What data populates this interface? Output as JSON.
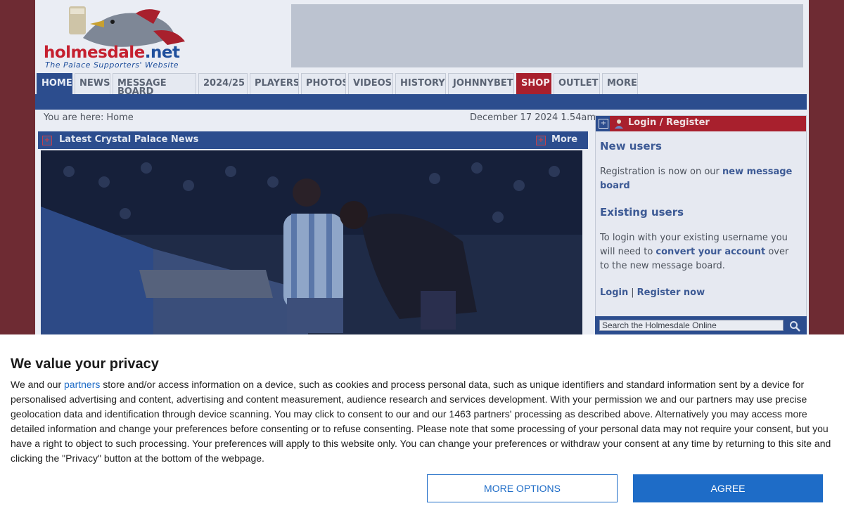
{
  "logo": {
    "name_main": "holmesdale",
    "name_suffix": ".net",
    "tagline": "The Palace Supporters' Website"
  },
  "nav": {
    "tabs": [
      {
        "label": "HOME",
        "name": "tab-home"
      },
      {
        "label": "NEWS",
        "name": "tab-news"
      },
      {
        "label": "MESSAGE BOARD",
        "name": "tab-message-board"
      },
      {
        "label": "2024/25",
        "name": "tab-2024-25"
      },
      {
        "label": "PLAYERS",
        "name": "tab-players"
      },
      {
        "label": "PHOTOS",
        "name": "tab-photos"
      },
      {
        "label": "VIDEOS",
        "name": "tab-videos"
      },
      {
        "label": "HISTORY",
        "name": "tab-history"
      },
      {
        "label": "JOHNNYBET",
        "name": "tab-johnnybet"
      },
      {
        "label": "SHOP",
        "name": "tab-shop"
      },
      {
        "label": "OUTLET",
        "name": "tab-outlet"
      },
      {
        "label": "MORE",
        "name": "tab-more"
      }
    ]
  },
  "breadcrumb": {
    "prefix": "You are here:",
    "current": "Home"
  },
  "date": "December 17 2024 1.54am",
  "news": {
    "title": "Latest Crystal Palace News",
    "more": "More"
  },
  "sidebar": {
    "login_title": "Login / Register",
    "new_users_heading": "New users",
    "new_users_text": "Registration is now on our",
    "new_users_link": "new message board",
    "existing_heading": "Existing users",
    "existing_text_1": "To login with your existing username you will need to",
    "existing_link": "convert your account",
    "existing_text_2": "over to the new message board.",
    "login_link": "Login",
    "separator": "|",
    "register_link": "Register now"
  },
  "search": {
    "placeholder": "Search the Holmesdale Online"
  },
  "consent": {
    "heading": "We value your privacy",
    "text_1": "We and our",
    "partners_link": "partners",
    "text_2": "store and/or access information on a device, such as cookies and process personal data, such as unique identifiers and standard information sent by a device for personalised advertising and content, advertising and content measurement, audience research and services development. With your permission we and our partners may use precise geolocation data and identification through device scanning. You may click to consent to our and our 1463 partners' processing as described above. Alternatively you may access more detailed information and change your preferences before consenting or to refuse consenting. Please note that some processing of your personal data may not require your consent, but you have a right to object to such processing. Your preferences will apply to this website only. You can change your preferences or withdraw your consent at any time by returning to this site and clicking the \"Privacy\" button at the bottom of the webpage.",
    "more_options": "MORE OPTIONS",
    "agree": "AGREE"
  },
  "colors": {
    "brand_red": "#a8202d",
    "brand_blue": "#2c4d8e",
    "consent_blue": "#1e6cc7"
  },
  "icons": [
    "expand-box-icon",
    "user-icon",
    "search-icon",
    "site-logo-bird-icon"
  ]
}
